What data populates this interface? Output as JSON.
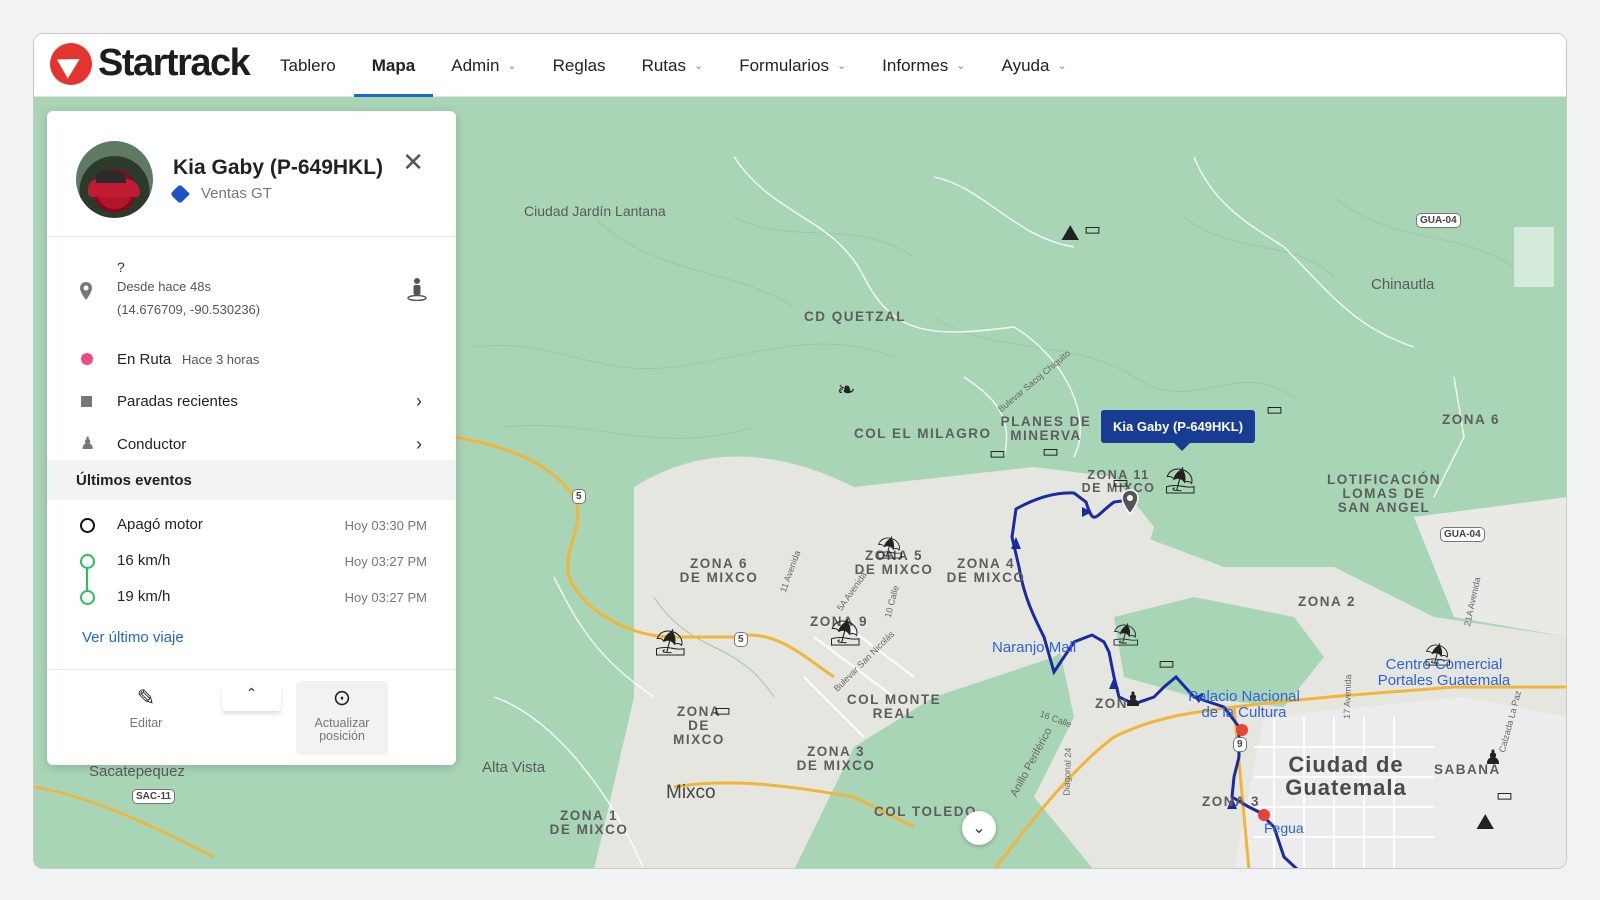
{
  "brand": {
    "name": "Startrack",
    "accent": "#e3342f"
  },
  "nav": [
    {
      "label": "Tablero",
      "dropdown": false,
      "active": false
    },
    {
      "label": "Mapa",
      "dropdown": false,
      "active": true
    },
    {
      "label": "Admin",
      "dropdown": true,
      "active": false
    },
    {
      "label": "Reglas",
      "dropdown": false,
      "active": false
    },
    {
      "label": "Rutas",
      "dropdown": true,
      "active": false
    },
    {
      "label": "Formularios",
      "dropdown": true,
      "active": false
    },
    {
      "label": "Informes",
      "dropdown": true,
      "active": false
    },
    {
      "label": "Ayuda",
      "dropdown": true,
      "active": false
    }
  ],
  "panel": {
    "vehicle_name": "Kia Gaby (P-649HKL)",
    "group": "Ventas GT",
    "location": {
      "address": "?",
      "since": "Desde hace 48s",
      "coords": "(14.676709, -90.530236)"
    },
    "status": {
      "label": "En Ruta",
      "since": "Hace 3 horas",
      "color": "#e84a8a"
    },
    "recent_stops": "Paradas recientes",
    "driver": "Conductor",
    "events_title": "Últimos eventos",
    "events": [
      {
        "label": "Apagó motor",
        "time": "Hoy 03:30 PM"
      },
      {
        "label": "16 km/h",
        "time": "Hoy 03:27 PM"
      },
      {
        "label": "19 km/h",
        "time": "Hoy 03:27 PM"
      }
    ],
    "last_trip_link": "Ver último viaje",
    "edit_label": "Editar",
    "update_label": "Actualizar posición"
  },
  "map": {
    "tooltip": "Kia Gaby (P-649HKL)",
    "route_color": "#1b2aa3",
    "labels": {
      "ciudad_jardin": "Ciudad Jardín Lantana",
      "cd_quetzal": "CD QUETZAL",
      "chinautla": "Chinautla",
      "col_el_milagro": "COL EL MILAGRO",
      "planes_minerva": "PLANES DE MINERVA",
      "zona6_right": "ZONA 6",
      "lotificacion": "LOTIFICACIÓN LOMAS DE SAN ANGEL",
      "zona11": "ZONA 11 DE MIXCO",
      "zona6_mixco": "ZONA 6 DE MIXCO",
      "zona5_mixco": "ZONA 5 DE MIXCO",
      "zona4_mixco": "ZONA 4 DE MIXCO",
      "zona2": "ZONA 2",
      "zona9": "ZONA 9",
      "naranjo_mall": "Naranjo Mall",
      "centro_comercial": "Centro Comercial Portales Guatemala",
      "palacio": "Palacio Nacional de la Cultura",
      "col_monte_real": "COL MONTE REAL",
      "zona_mixco_left": "ZONA DE MIXCO",
      "zona3_mixco": "ZONA 3 DE MIXCO",
      "alta_vista": "Alta Vista",
      "mixco": "Mixco",
      "col_toledo": "COL TOLEDO",
      "ciudad_guatemala": "Ciudad de Guatemala",
      "zona3": "ZONA 3",
      "zona1_mixco": "ZONA 1 DE MIXCO",
      "sacatepequez": "Sacatepequez",
      "sabana": "SABANA",
      "zona_short": "ZON",
      "fegua": "Fegua",
      "anillo": "Anillo Periférico",
      "calle16": "16 Calle",
      "avenida11": "11 Avenida",
      "bulevar_san_nicolas": "Bulevar San Nicolás",
      "bulevar_sacoj": "Bulevar Sacoj Chiquito",
      "diagonal24": "Diagonal 24",
      "avenida21a": "21A Avenida",
      "avenida17": "17 Avenida",
      "calzada_paz": "Calzada La Paz",
      "calle10": "10 Calle",
      "avenida5a": "5A Avenida"
    },
    "shields": {
      "gua04_top": "GUA-04",
      "gua04_mid": "GUA-04",
      "r5_a": "5",
      "r5_b": "5",
      "r9": "9",
      "sac11": "SAC-11"
    }
  }
}
